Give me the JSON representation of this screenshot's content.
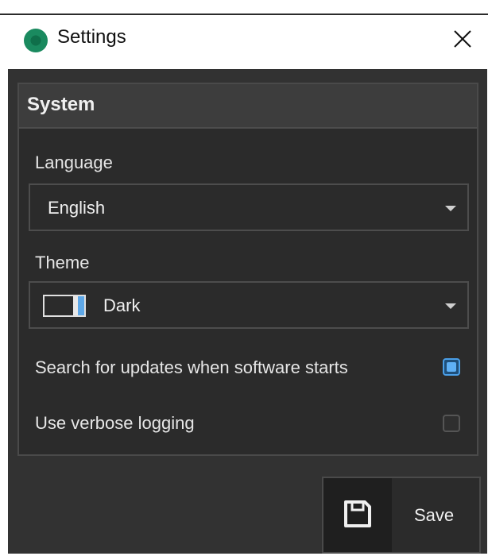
{
  "window": {
    "title": "Settings",
    "close_symbol": "✕"
  },
  "panel": {
    "title": "System"
  },
  "language": {
    "label": "Language",
    "selected": "English"
  },
  "theme": {
    "label": "Theme",
    "selected": "Dark"
  },
  "options": {
    "updates_label": "Search for updates when software starts",
    "updates_checked": true,
    "verbose_label": "Use verbose logging",
    "verbose_checked": false
  },
  "footer": {
    "save_label": "Save"
  },
  "colors": {
    "background": "#323232",
    "panel": "#2b2b2b",
    "accent": "#4a9fe8",
    "app_icon": "#1a8a5f"
  },
  "icons": {
    "app": "app-logo-icon",
    "close": "close-icon",
    "dropdown": "chevron-down-icon",
    "theme": "theme-preview-icon",
    "save": "floppy-disk-icon"
  }
}
